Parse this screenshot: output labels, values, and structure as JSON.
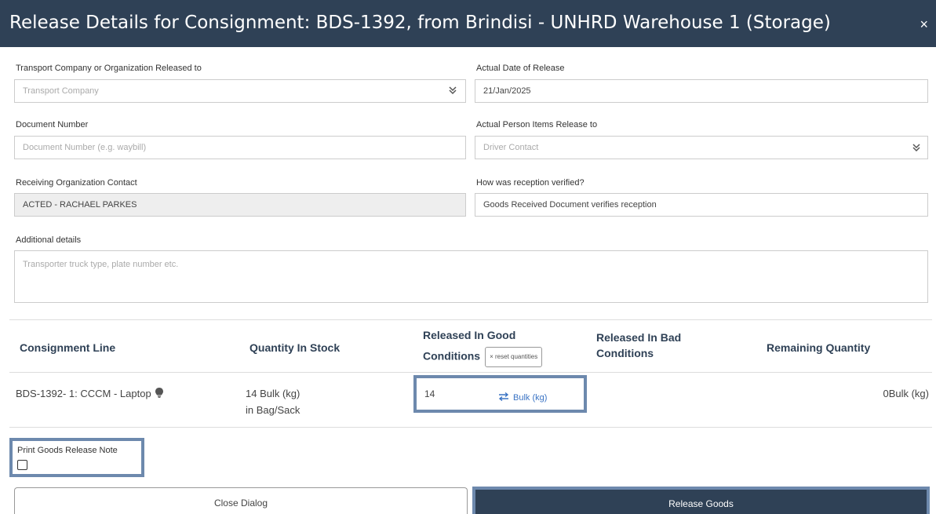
{
  "dialog": {
    "title": "Release Details for Consignment: BDS-1392, from Brindisi - UNHRD Warehouse 1 (Storage)",
    "close_symbol": "×"
  },
  "form": {
    "transport_company": {
      "label": "Transport Company or Organization Released to",
      "placeholder": "Transport Company",
      "value": ""
    },
    "release_date": {
      "label": "Actual Date of Release",
      "value": "21/Jan/2025"
    },
    "document_number": {
      "label": "Document Number",
      "placeholder": "Document Number (e.g. waybill)",
      "value": ""
    },
    "person_released_to": {
      "label": "Actual Person Items Release to",
      "placeholder": "Driver Contact",
      "value": ""
    },
    "receiving_contact": {
      "label": "Receiving Organization Contact",
      "value": "ACTED - RACHAEL PARKES"
    },
    "reception_verified": {
      "label": "How was reception verified?",
      "value": "Goods Received Document verifies reception"
    },
    "additional_details": {
      "label": "Additional details",
      "placeholder": "Transporter truck type, plate number etc.",
      "value": ""
    }
  },
  "table": {
    "headers": {
      "consignment_line": "Consignment Line",
      "quantity_in_stock": "Quantity In Stock",
      "released_good_line1": "Released In Good",
      "released_good_line2": "Conditions",
      "reset_quantities": "× reset quantities",
      "released_bad_line1": "Released In Bad",
      "released_bad_line2": "Conditions",
      "remaining_quantity": "Remaining Quantity"
    },
    "rows": [
      {
        "consignment_line": "BDS-1392- 1: CCCM - Laptop",
        "stock_line1": "14 Bulk (kg)",
        "stock_line2": "in Bag/Sack",
        "released_good_value": "14",
        "released_good_unit": "Bulk (kg)",
        "remaining": "0Bulk (kg)"
      }
    ]
  },
  "print_note": {
    "label": "Print Goods Release Note",
    "checked": false
  },
  "buttons": {
    "close": "Close Dialog",
    "release": "Release Goods"
  },
  "colors": {
    "header_bg": "#2f4156",
    "highlight_border": "#6d89ad",
    "link_blue": "#3a73c4"
  }
}
